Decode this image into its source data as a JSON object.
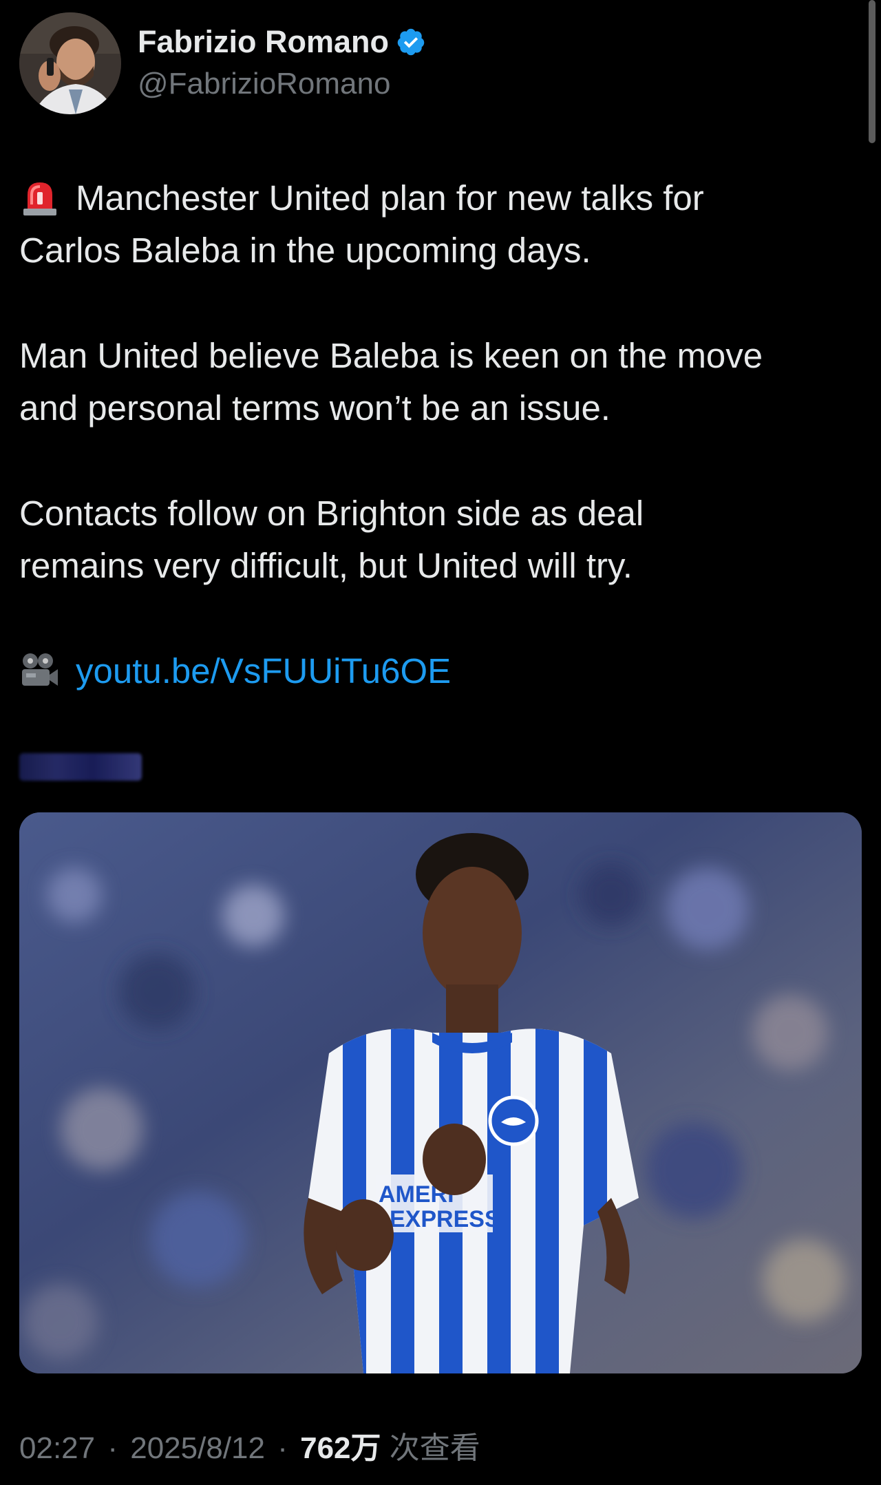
{
  "author": {
    "display_name": "Fabrizio Romano",
    "handle": "@FabrizioRomano",
    "verified": true
  },
  "tweet": {
    "paragraphs": [
      {
        "icon": "rotating-light-icon",
        "lines": [
          "Manchester United plan for new talks for",
          "Carlos Baleba in the upcoming days."
        ]
      },
      {
        "lines": [
          "Man United believe Baleba is keen on the move",
          "and personal terms won’t be an issue."
        ]
      },
      {
        "lines": [
          "Contacts follow on Brighton side as deal",
          "remains very difficult, but United will try."
        ]
      }
    ],
    "link": {
      "icon": "movie-camera-icon",
      "text": "youtu.be/VsFUUiTu6OE"
    }
  },
  "media": {
    "jersey_sponsor_line1": "AMERI",
    "jersey_sponsor_line2": "EXPRESS"
  },
  "footer": {
    "time": "02:27",
    "date": "2025/8/12",
    "views_count": "762万",
    "views_label": "次查看",
    "separator": "·"
  },
  "colors": {
    "background": "#000000",
    "text": "#e7e9ea",
    "muted": "#71767b",
    "link": "#1d9bf0",
    "verified": "#1d9bf0"
  }
}
